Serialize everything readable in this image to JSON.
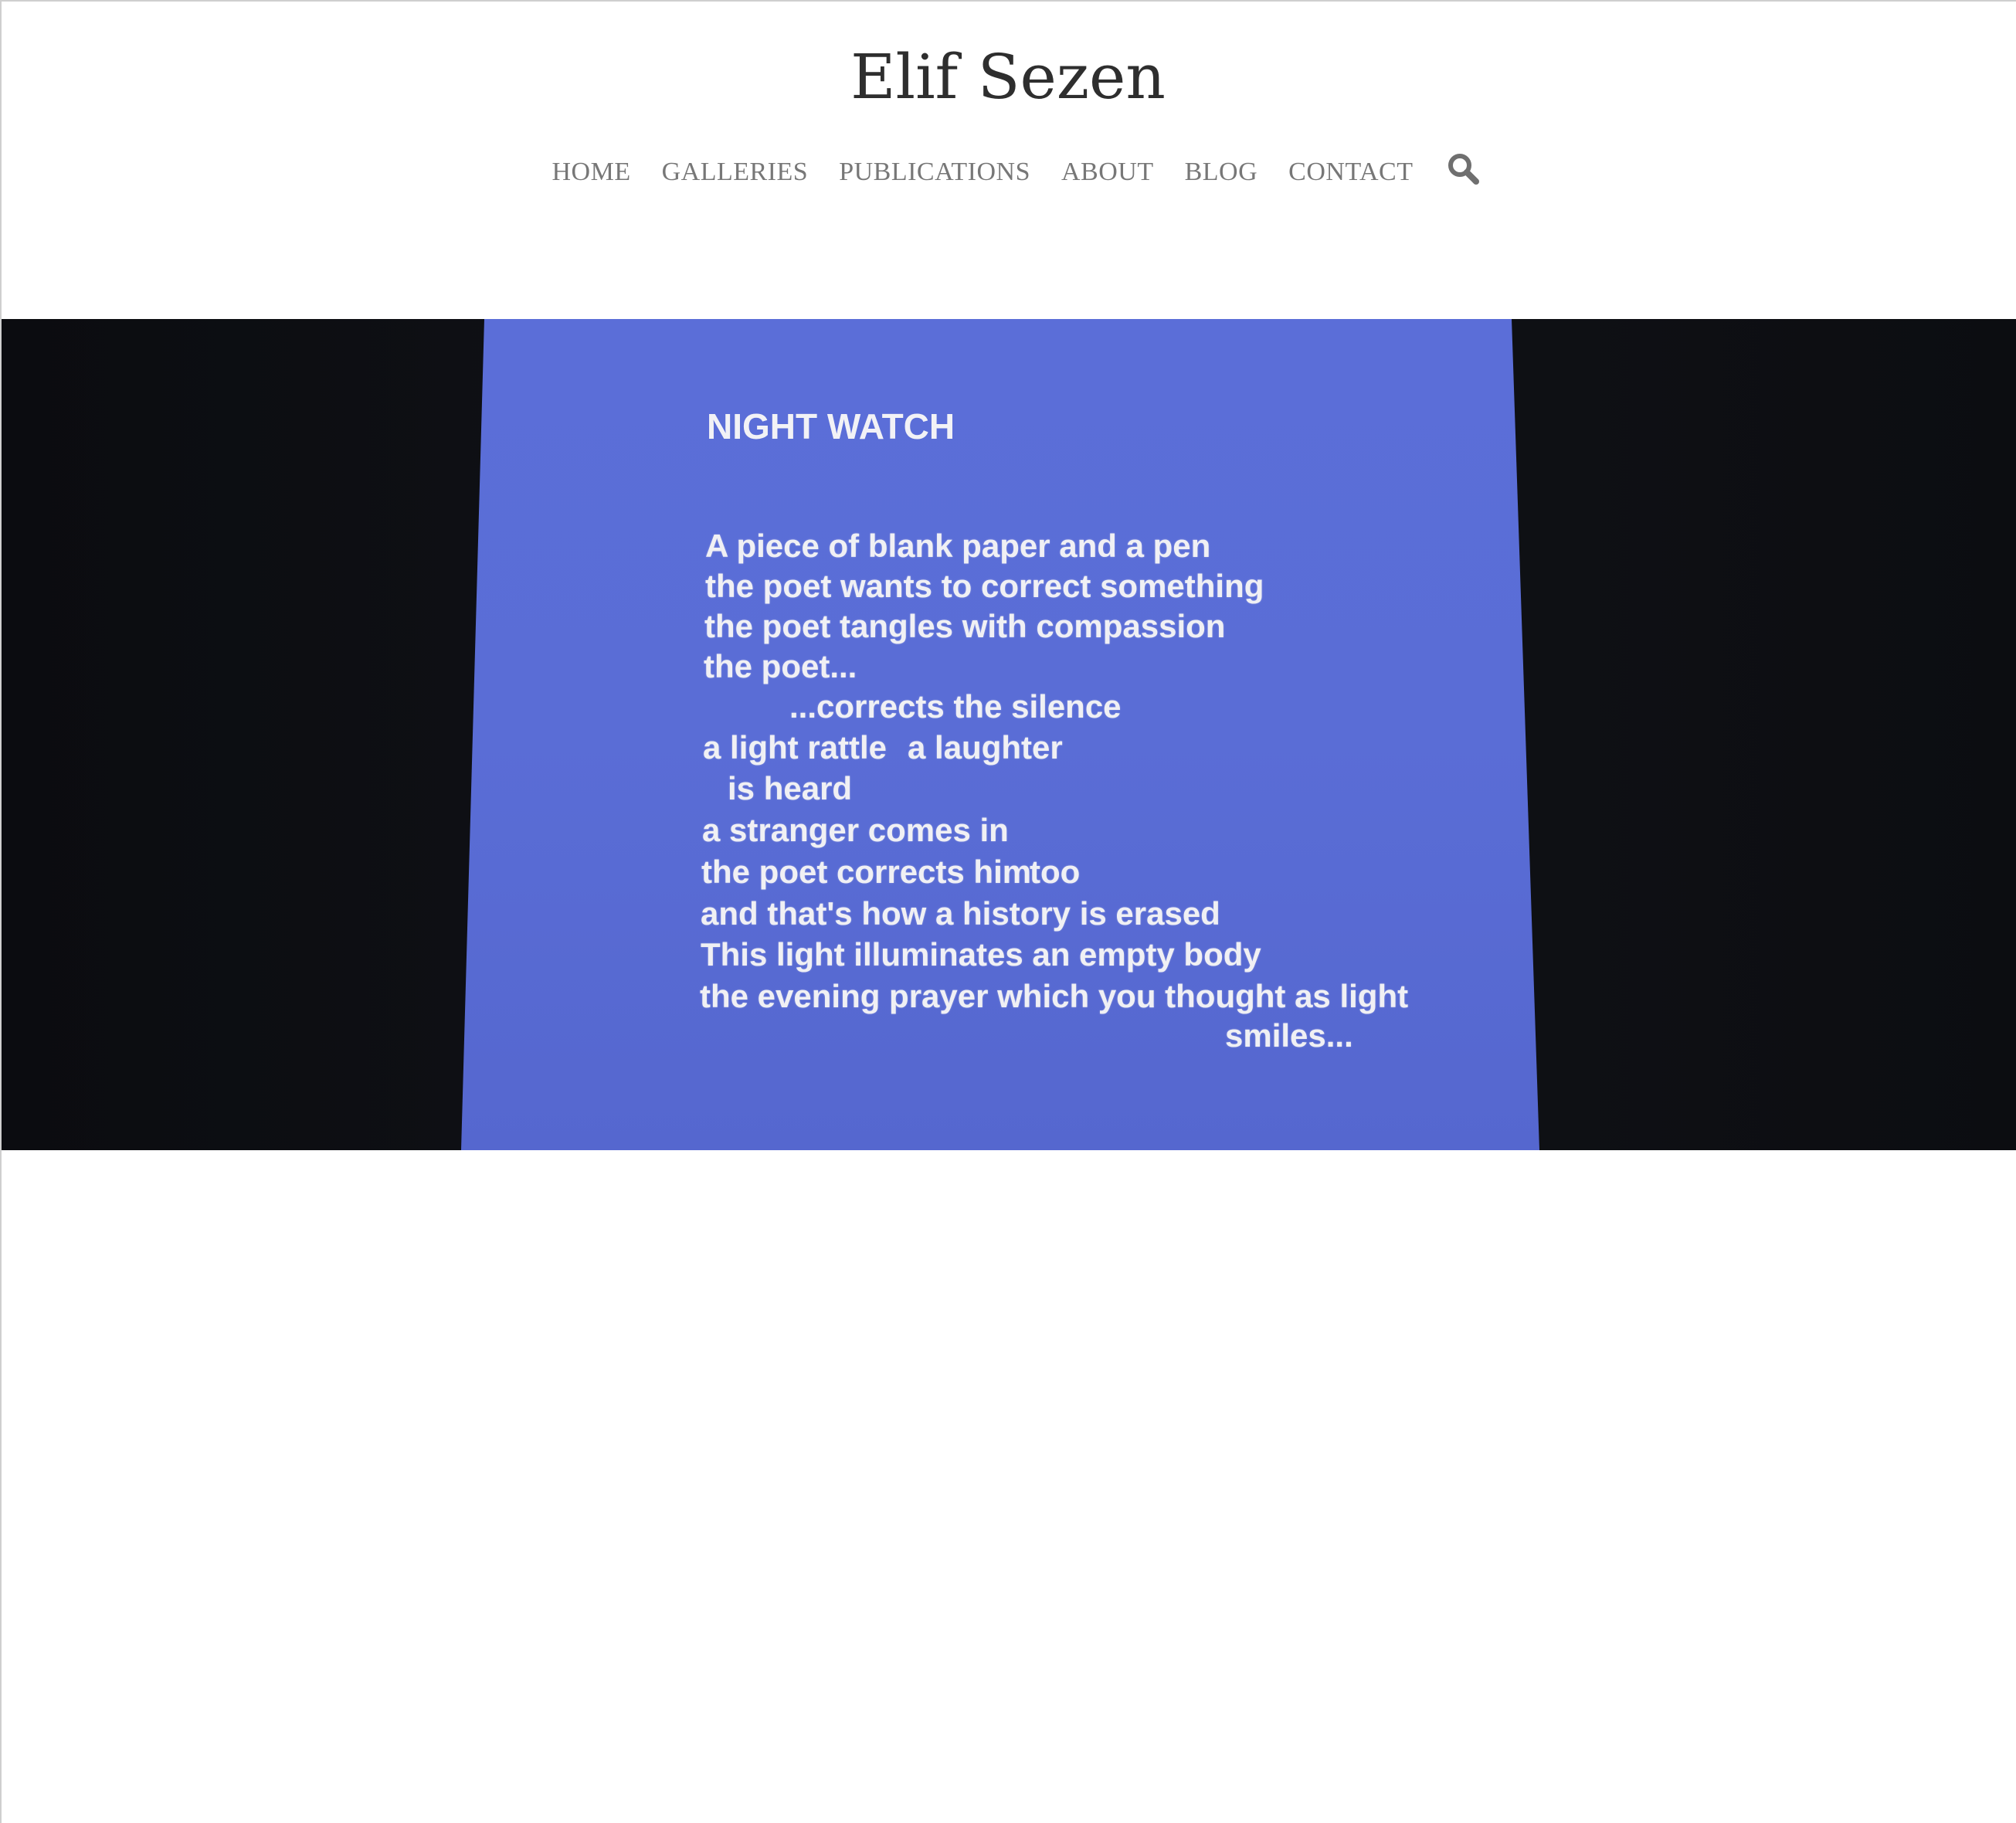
{
  "site": {
    "title": "Elif Sezen"
  },
  "nav": {
    "items": [
      {
        "label": "HOME"
      },
      {
        "label": "GALLERIES"
      },
      {
        "label": "PUBLICATIONS"
      },
      {
        "label": "ABOUT"
      },
      {
        "label": "BLOG"
      },
      {
        "label": "CONTACT"
      }
    ],
    "search_icon": "search-icon"
  },
  "hero": {
    "poem_title": "NIGHT WATCH",
    "lines": [
      "A piece of blank paper and a pen",
      "the poet wants to correct something",
      "the poet tangles with compassion",
      "the poet...",
      "...corrects the silence",
      "a light rattle",
      "a laughter",
      "is heard",
      "a stranger comes in",
      "the poet corrects him",
      "too",
      "and that's how a history is erased",
      "This light illuminates an empty body",
      "the evening prayer which you thought as light",
      "smiles..."
    ]
  },
  "colors": {
    "projection_blue": "#5a6fd6",
    "background_dark": "#0d0f14",
    "nav_text": "#777777",
    "title_text": "#2e2e2e"
  }
}
